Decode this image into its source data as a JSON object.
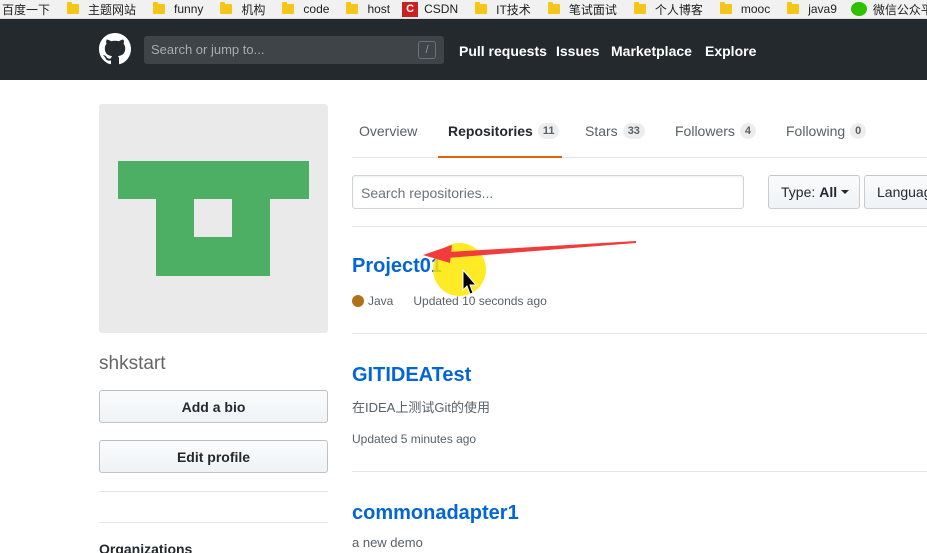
{
  "bookmarks": [
    {
      "label": "百度一下",
      "icon": "none"
    },
    {
      "label": "主题网站",
      "icon": "folder-icon"
    },
    {
      "label": "funny",
      "icon": "folder-icon"
    },
    {
      "label": "机构",
      "icon": "folder-icon"
    },
    {
      "label": "code",
      "icon": "folder-icon"
    },
    {
      "label": "host",
      "icon": "folder-icon"
    },
    {
      "label": "CSDN",
      "icon": "csdn-icon"
    },
    {
      "label": "IT技术",
      "icon": "folder-icon"
    },
    {
      "label": "笔试面试",
      "icon": "folder-icon"
    },
    {
      "label": "个人博客",
      "icon": "folder-icon"
    },
    {
      "label": "mooc",
      "icon": "folder-icon"
    },
    {
      "label": "java9",
      "icon": "folder-icon"
    },
    {
      "label": "微信公众平台",
      "icon": "wechat-icon"
    }
  ],
  "header": {
    "search_placeholder": "Search or jump to...",
    "search_shortcut": "/",
    "nav": [
      "Pull requests",
      "Issues",
      "Marketplace",
      "Explore"
    ]
  },
  "profile": {
    "username": "shkstart",
    "add_bio_label": "Add a bio",
    "edit_profile_label": "Edit profile",
    "organizations_heading": "Organizations",
    "avatar_color": "#4caf63"
  },
  "tabs": [
    {
      "label": "Overview",
      "count": ""
    },
    {
      "label": "Repositories",
      "count": "11"
    },
    {
      "label": "Stars",
      "count": "33"
    },
    {
      "label": "Followers",
      "count": "4"
    },
    {
      "label": "Following",
      "count": "0"
    }
  ],
  "filters": {
    "search_placeholder": "Search repositories...",
    "type_label": "Type:",
    "type_value": "All",
    "language_label": "Languag"
  },
  "repos": [
    {
      "name": "Project01",
      "description": "",
      "language": "Java",
      "language_color": "#b07219",
      "updated": "Updated 10 seconds ago"
    },
    {
      "name": "GITIDEATest",
      "description": "在IDEA上测试Git的使用",
      "language": "",
      "language_color": "",
      "updated": "Updated 5 minutes ago"
    },
    {
      "name": "commonadapter1",
      "description": "a new demo",
      "language": "",
      "language_color": "",
      "updated": ""
    }
  ],
  "colors": {
    "header_bg": "#24292e",
    "link": "#0366d6",
    "tab_accent": "#e36209",
    "arrow": "#f03c3c",
    "highlight": "#ffe600"
  }
}
